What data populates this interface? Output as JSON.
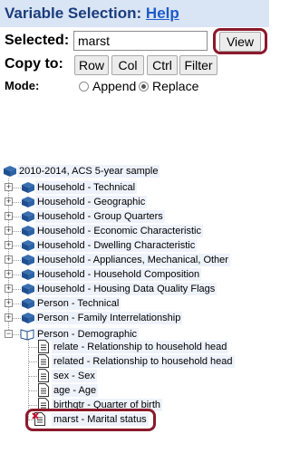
{
  "header": {
    "title": "Variable Selection:",
    "help_link": "Help"
  },
  "selected": {
    "label": "Selected:",
    "value": "marst",
    "view_button": "View"
  },
  "copy_to": {
    "label": "Copy to:",
    "buttons": [
      "Row",
      "Col",
      "Ctrl",
      "Filter"
    ]
  },
  "mode": {
    "label": "Mode:",
    "options": [
      {
        "label": "Append",
        "checked": false
      },
      {
        "label": "Replace",
        "checked": true
      }
    ]
  },
  "tree": {
    "root": "2010-2014, ACS 5-year sample",
    "groups": [
      "Household - Technical",
      "Household - Geographic",
      "Household - Group Quarters",
      "Household - Economic Characteristic",
      "Household - Dwelling Characteristic",
      "Household - Appliances, Mechanical, Other",
      "Household - Household Composition",
      "Household - Housing Data Quality Flags",
      "Person - Technical",
      "Person - Family Interrelationship"
    ],
    "open_group": "Person - Demographic",
    "variables": [
      "relate - Relationship to household head",
      "related - Relationship to household head",
      "sex - Sex",
      "age - Age",
      "birthqtr - Quarter of birth",
      "marst - Marital status"
    ]
  }
}
